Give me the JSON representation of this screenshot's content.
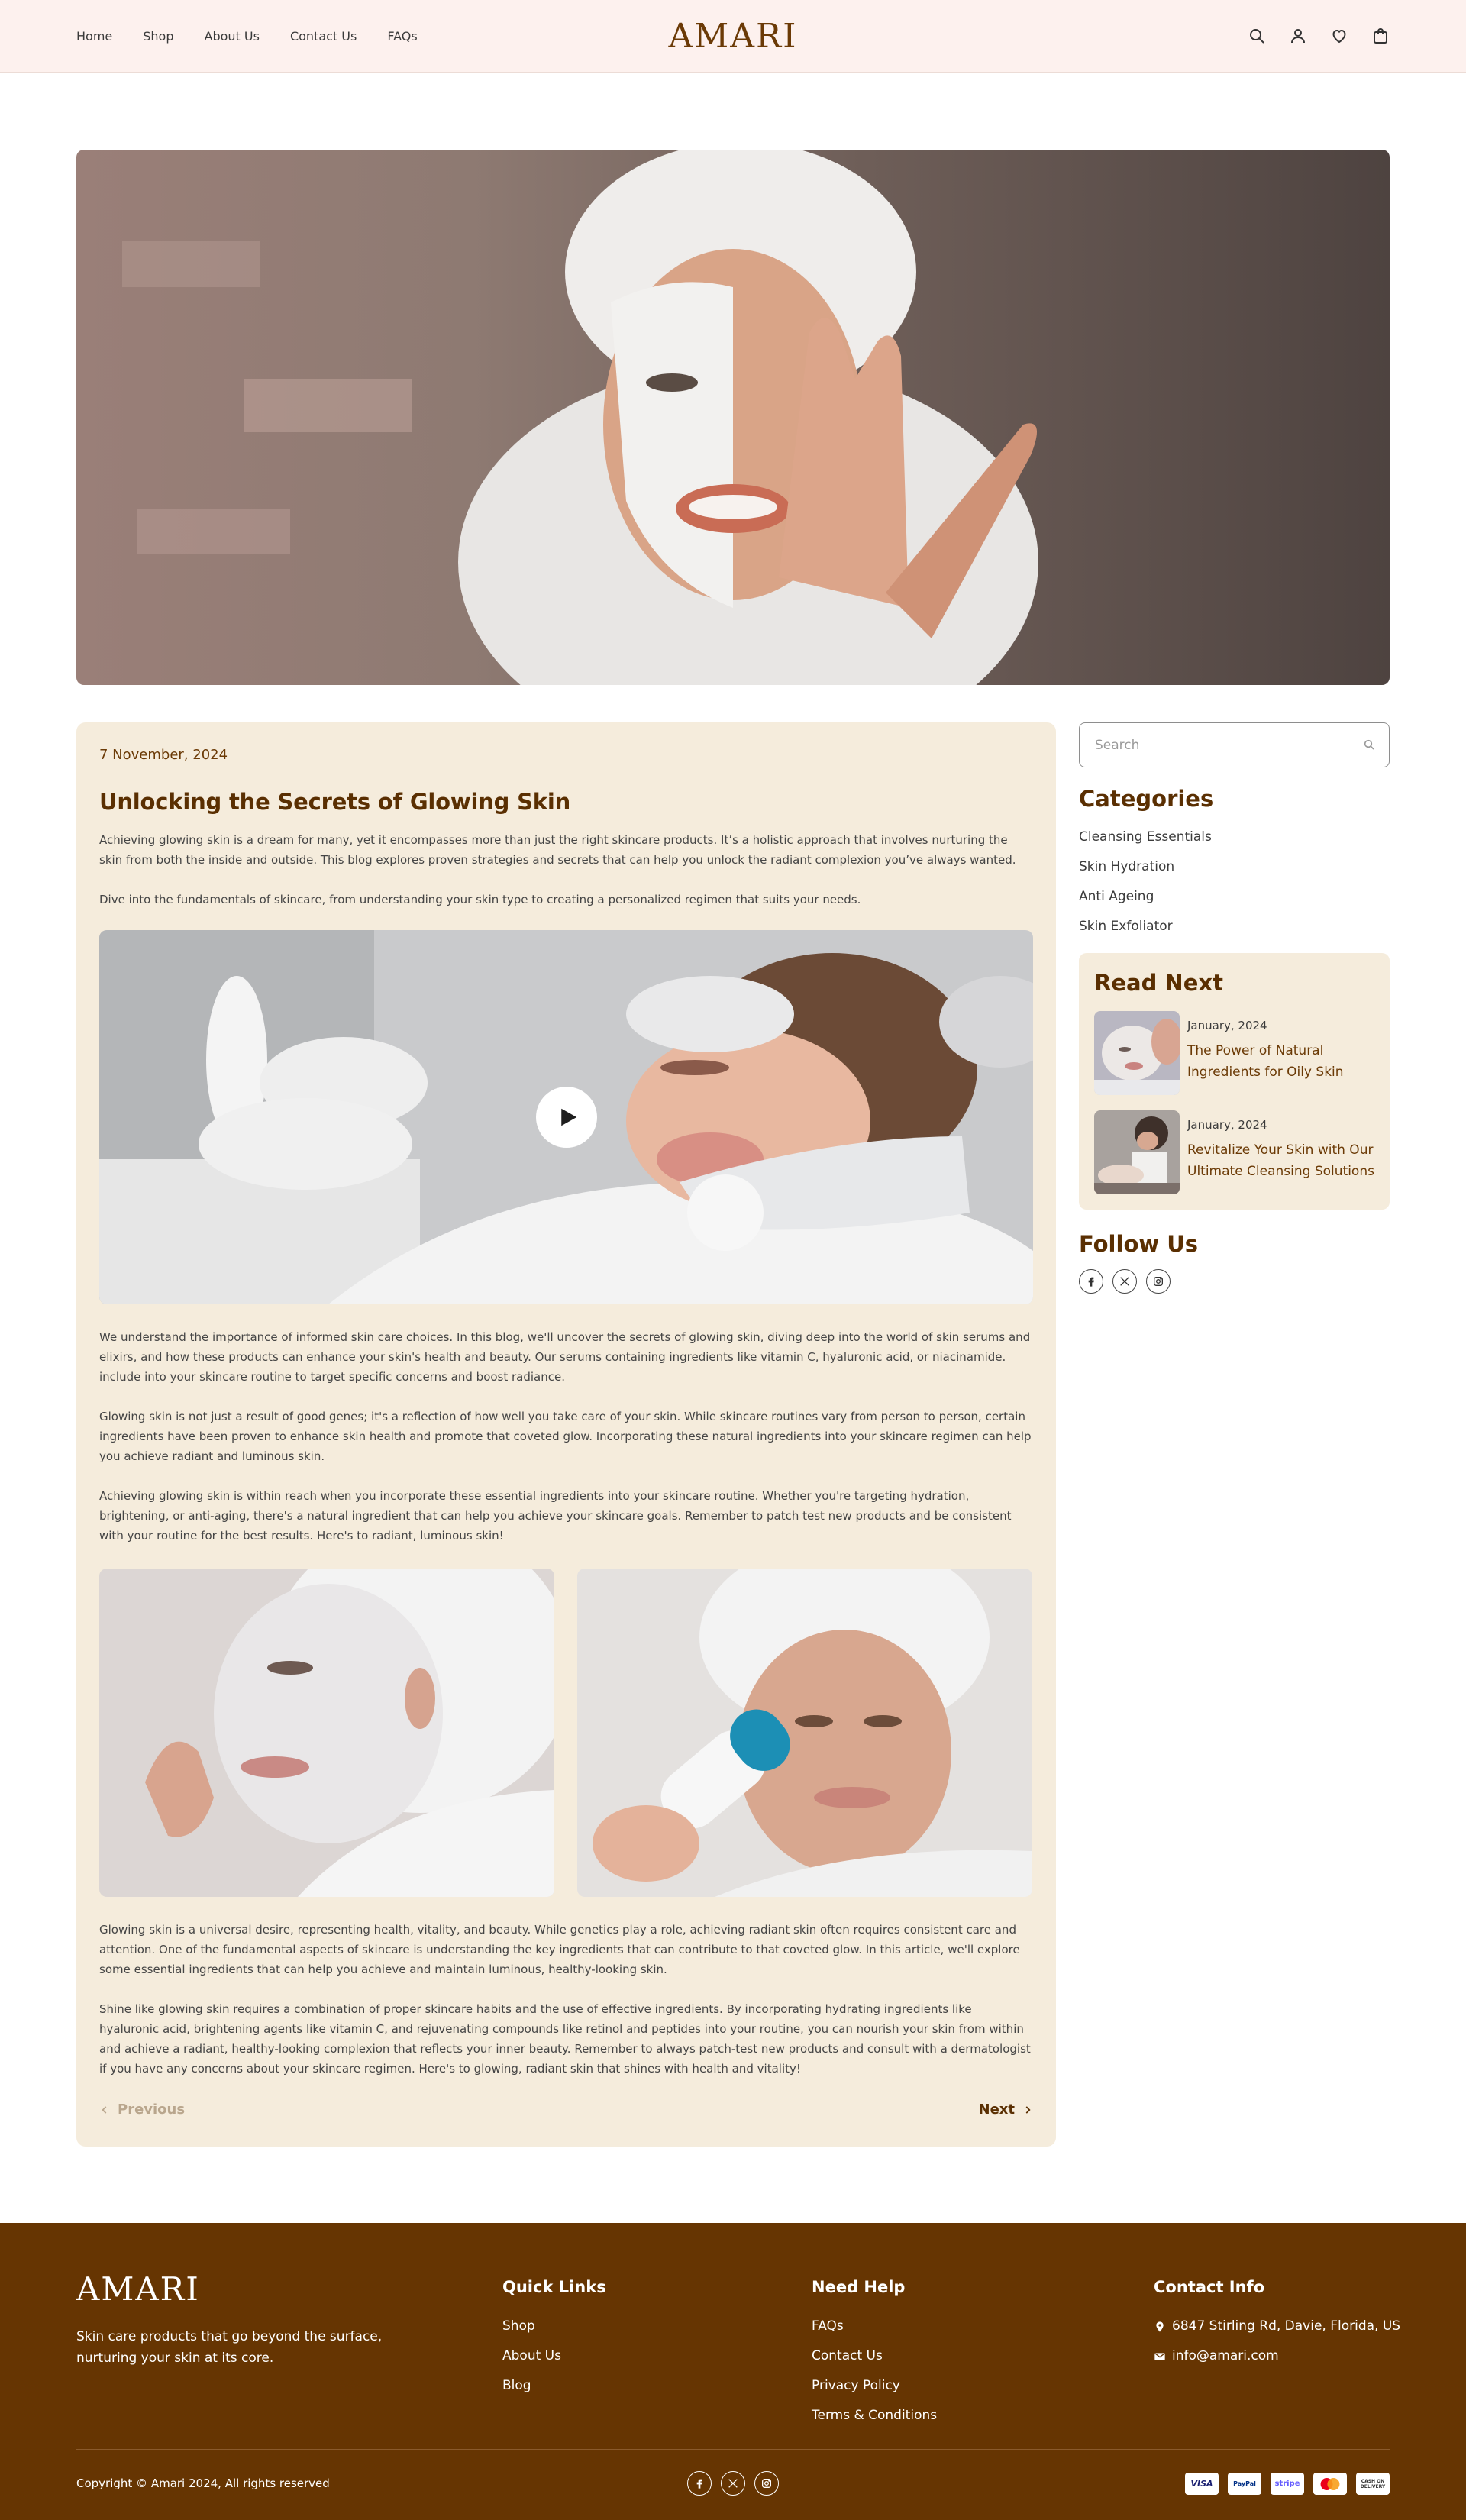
{
  "header": {
    "nav": [
      "Home",
      "Shop",
      "About Us",
      "Contact Us",
      "FAQs"
    ],
    "logo": "AMARI",
    "icons": [
      "search-icon",
      "user-icon",
      "heart-icon",
      "bag-icon"
    ]
  },
  "article": {
    "date": "7 November, 2024",
    "title": "Unlocking the Secrets of Glowing Skin",
    "paragraphs": [
      "Achieving glowing skin is a dream for many, yet it encompasses more than just the right skincare products. It’s a holistic approach that involves nurturing the skin from both the inside and outside. This blog explores proven strategies and secrets that can help you unlock the radiant complexion you’ve always wanted.",
      "Dive into the fundamentals of skincare, from understanding your skin type to creating a personalized regimen that suits your needs.",
      "We understand the importance of informed skin care choices. In this blog, we'll uncover the secrets of glowing skin, diving deep into the world of skin serums and elixirs, and how these products can enhance your skin's health and beauty. Our serums containing ingredients like vitamin C, hyaluronic acid, or niacinamide. include into your skincare routine to target specific concerns and boost radiance.",
      "Glowing skin is not just a result of good genes; it's a reflection of how well you take care of your skin. While skincare routines vary from person to person, certain ingredients have been proven to enhance skin health and promote that coveted glow. Incorporating these natural ingredients into your skincare regimen can help you achieve radiant and luminous skin.",
      "Achieving glowing skin is within reach when you incorporate these essential ingredients into your skincare routine. Whether you're targeting hydration, brightening, or anti-aging, there's a natural ingredient that can help you achieve your skincare goals. Remember to patch test new products and be consistent with your routine for the best results. Here's to radiant, luminous skin!",
      "Glowing skin is a universal desire, representing health, vitality, and beauty. While genetics play a role, achieving radiant skin often requires consistent care and attention. One of the fundamental aspects of skincare is understanding the key ingredients that can contribute to that coveted glow. In this article, we'll explore some essential ingredients that can help you achieve and maintain luminous, healthy-looking skin.",
      "Shine like glowing skin requires a combination of proper skincare habits and the use of effective ingredients. By incorporating hydrating ingredients like hyaluronic acid, brightening agents like vitamin C, and rejuvenating compounds like retinol and peptides into your routine, you can nourish your skin from within and achieve a radiant, healthy-looking complexion that reflects your inner beauty. Remember to always patch-test new products and consult with a dermatologist if you have any concerns about your skincare regimen. Here's to glowing, radiant skin that shines with health and vitality!"
    ],
    "prev_label": "Previous",
    "next_label": "Next"
  },
  "sidebar": {
    "search_placeholder": "Search",
    "categories_title": "Categories",
    "categories": [
      "Cleansing Essentials",
      "Skin Hydration",
      "Anti Ageing",
      "Skin Exfoliator"
    ],
    "read_next_title": "Read Next",
    "read_next": [
      {
        "date": "January, 2024",
        "title": "The Power of Natural Ingredients for Oily Skin"
      },
      {
        "date": "January, 2024",
        "title": "Revitalize Your Skin with Our Ultimate Cleansing Solutions"
      }
    ],
    "follow_title": "Follow Us",
    "social": [
      "facebook-icon",
      "x-icon",
      "instagram-icon"
    ]
  },
  "footer": {
    "logo": "AMARI",
    "tagline": "Skin care products that go beyond the surface, nurturing your skin at its core.",
    "quick_links_title": "Quick Links",
    "quick_links": [
      "Shop",
      "About Us",
      "Blog"
    ],
    "help_title": "Need Help",
    "help_links": [
      "FAQs",
      "Contact Us",
      "Privacy Policy",
      "Terms & Conditions"
    ],
    "contact_title": "Contact Info",
    "address": "6847 Stirling Rd, Davie, Florida, US",
    "email": "info@amari.com",
    "copyright": "Copyright © Amari 2024, All rights reserved",
    "payments": [
      "VISA",
      "PayPal",
      "stripe",
      "mastercard",
      "CASH ON DELIVERY"
    ]
  },
  "colors": {
    "header_bg": "#fdf1ee",
    "brand_brown": "#6b3a06",
    "card_bg": "#f5ecdc",
    "footer_bg": "#663502"
  }
}
